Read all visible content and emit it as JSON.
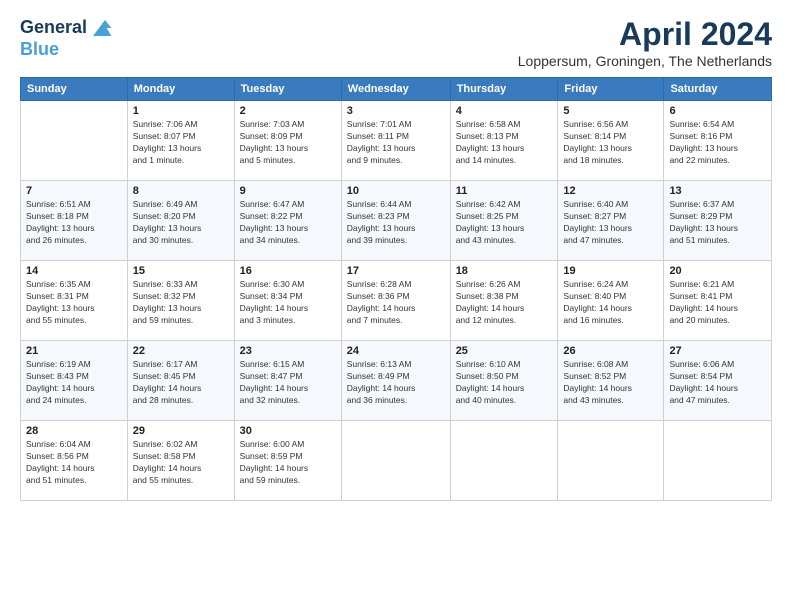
{
  "header": {
    "logo_line1": "General",
    "logo_line2": "Blue",
    "month_year": "April 2024",
    "location": "Loppersum, Groningen, The Netherlands"
  },
  "columns": [
    "Sunday",
    "Monday",
    "Tuesday",
    "Wednesday",
    "Thursday",
    "Friday",
    "Saturday"
  ],
  "weeks": [
    [
      {
        "num": "",
        "info": ""
      },
      {
        "num": "1",
        "info": "Sunrise: 7:06 AM\nSunset: 8:07 PM\nDaylight: 13 hours\nand 1 minute."
      },
      {
        "num": "2",
        "info": "Sunrise: 7:03 AM\nSunset: 8:09 PM\nDaylight: 13 hours\nand 5 minutes."
      },
      {
        "num": "3",
        "info": "Sunrise: 7:01 AM\nSunset: 8:11 PM\nDaylight: 13 hours\nand 9 minutes."
      },
      {
        "num": "4",
        "info": "Sunrise: 6:58 AM\nSunset: 8:13 PM\nDaylight: 13 hours\nand 14 minutes."
      },
      {
        "num": "5",
        "info": "Sunrise: 6:56 AM\nSunset: 8:14 PM\nDaylight: 13 hours\nand 18 minutes."
      },
      {
        "num": "6",
        "info": "Sunrise: 6:54 AM\nSunset: 8:16 PM\nDaylight: 13 hours\nand 22 minutes."
      }
    ],
    [
      {
        "num": "7",
        "info": "Sunrise: 6:51 AM\nSunset: 8:18 PM\nDaylight: 13 hours\nand 26 minutes."
      },
      {
        "num": "8",
        "info": "Sunrise: 6:49 AM\nSunset: 8:20 PM\nDaylight: 13 hours\nand 30 minutes."
      },
      {
        "num": "9",
        "info": "Sunrise: 6:47 AM\nSunset: 8:22 PM\nDaylight: 13 hours\nand 34 minutes."
      },
      {
        "num": "10",
        "info": "Sunrise: 6:44 AM\nSunset: 8:23 PM\nDaylight: 13 hours\nand 39 minutes."
      },
      {
        "num": "11",
        "info": "Sunrise: 6:42 AM\nSunset: 8:25 PM\nDaylight: 13 hours\nand 43 minutes."
      },
      {
        "num": "12",
        "info": "Sunrise: 6:40 AM\nSunset: 8:27 PM\nDaylight: 13 hours\nand 47 minutes."
      },
      {
        "num": "13",
        "info": "Sunrise: 6:37 AM\nSunset: 8:29 PM\nDaylight: 13 hours\nand 51 minutes."
      }
    ],
    [
      {
        "num": "14",
        "info": "Sunrise: 6:35 AM\nSunset: 8:31 PM\nDaylight: 13 hours\nand 55 minutes."
      },
      {
        "num": "15",
        "info": "Sunrise: 6:33 AM\nSunset: 8:32 PM\nDaylight: 13 hours\nand 59 minutes."
      },
      {
        "num": "16",
        "info": "Sunrise: 6:30 AM\nSunset: 8:34 PM\nDaylight: 14 hours\nand 3 minutes."
      },
      {
        "num": "17",
        "info": "Sunrise: 6:28 AM\nSunset: 8:36 PM\nDaylight: 14 hours\nand 7 minutes."
      },
      {
        "num": "18",
        "info": "Sunrise: 6:26 AM\nSunset: 8:38 PM\nDaylight: 14 hours\nand 12 minutes."
      },
      {
        "num": "19",
        "info": "Sunrise: 6:24 AM\nSunset: 8:40 PM\nDaylight: 14 hours\nand 16 minutes."
      },
      {
        "num": "20",
        "info": "Sunrise: 6:21 AM\nSunset: 8:41 PM\nDaylight: 14 hours\nand 20 minutes."
      }
    ],
    [
      {
        "num": "21",
        "info": "Sunrise: 6:19 AM\nSunset: 8:43 PM\nDaylight: 14 hours\nand 24 minutes."
      },
      {
        "num": "22",
        "info": "Sunrise: 6:17 AM\nSunset: 8:45 PM\nDaylight: 14 hours\nand 28 minutes."
      },
      {
        "num": "23",
        "info": "Sunrise: 6:15 AM\nSunset: 8:47 PM\nDaylight: 14 hours\nand 32 minutes."
      },
      {
        "num": "24",
        "info": "Sunrise: 6:13 AM\nSunset: 8:49 PM\nDaylight: 14 hours\nand 36 minutes."
      },
      {
        "num": "25",
        "info": "Sunrise: 6:10 AM\nSunset: 8:50 PM\nDaylight: 14 hours\nand 40 minutes."
      },
      {
        "num": "26",
        "info": "Sunrise: 6:08 AM\nSunset: 8:52 PM\nDaylight: 14 hours\nand 43 minutes."
      },
      {
        "num": "27",
        "info": "Sunrise: 6:06 AM\nSunset: 8:54 PM\nDaylight: 14 hours\nand 47 minutes."
      }
    ],
    [
      {
        "num": "28",
        "info": "Sunrise: 6:04 AM\nSunset: 8:56 PM\nDaylight: 14 hours\nand 51 minutes."
      },
      {
        "num": "29",
        "info": "Sunrise: 6:02 AM\nSunset: 8:58 PM\nDaylight: 14 hours\nand 55 minutes."
      },
      {
        "num": "30",
        "info": "Sunrise: 6:00 AM\nSunset: 8:59 PM\nDaylight: 14 hours\nand 59 minutes."
      },
      {
        "num": "",
        "info": ""
      },
      {
        "num": "",
        "info": ""
      },
      {
        "num": "",
        "info": ""
      },
      {
        "num": "",
        "info": ""
      }
    ]
  ]
}
